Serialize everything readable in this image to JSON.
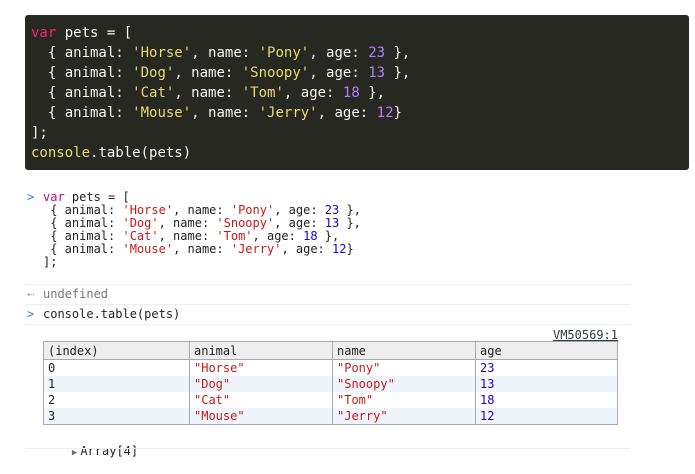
{
  "code_block": {
    "lines": [
      [
        {
          "t": "var",
          "c": "kw"
        },
        {
          "t": " pets = [",
          "c": ""
        }
      ],
      [
        {
          "t": "  { animal: ",
          "c": ""
        },
        {
          "t": "'Horse'",
          "c": "str"
        },
        {
          "t": ", name: ",
          "c": ""
        },
        {
          "t": "'Pony'",
          "c": "str"
        },
        {
          "t": ", age: ",
          "c": ""
        },
        {
          "t": "23",
          "c": "num"
        },
        {
          "t": " },",
          "c": ""
        }
      ],
      [
        {
          "t": "  { animal: ",
          "c": ""
        },
        {
          "t": "'Dog'",
          "c": "str"
        },
        {
          "t": ", name: ",
          "c": ""
        },
        {
          "t": "'Snoopy'",
          "c": "str"
        },
        {
          "t": ", age: ",
          "c": ""
        },
        {
          "t": "13",
          "c": "num"
        },
        {
          "t": " },",
          "c": ""
        }
      ],
      [
        {
          "t": "  { animal: ",
          "c": ""
        },
        {
          "t": "'Cat'",
          "c": "str"
        },
        {
          "t": ", name: ",
          "c": ""
        },
        {
          "t": "'Tom'",
          "c": "str"
        },
        {
          "t": ", age: ",
          "c": ""
        },
        {
          "t": "18",
          "c": "num"
        },
        {
          "t": " },",
          "c": ""
        }
      ],
      [
        {
          "t": "  { animal: ",
          "c": ""
        },
        {
          "t": "'Mouse'",
          "c": "str"
        },
        {
          "t": ", name: ",
          "c": ""
        },
        {
          "t": "'Jerry'",
          "c": "str"
        },
        {
          "t": ", age: ",
          "c": ""
        },
        {
          "t": "12",
          "c": "num"
        },
        {
          "t": "}",
          "c": ""
        }
      ],
      [
        {
          "t": "];",
          "c": ""
        }
      ],
      [
        {
          "t": "console",
          "c": "str"
        },
        {
          "t": ".table(pets)",
          "c": ""
        }
      ]
    ]
  },
  "console": {
    "input_lines": [
      [
        {
          "t": "var",
          "c": "c-kw"
        },
        {
          "t": " pets = [",
          "c": ""
        }
      ],
      [
        {
          "t": " { animal: ",
          "c": ""
        },
        {
          "t": "'Horse'",
          "c": "c-str"
        },
        {
          "t": ", name: ",
          "c": ""
        },
        {
          "t": "'Pony'",
          "c": "c-str"
        },
        {
          "t": ", age: ",
          "c": ""
        },
        {
          "t": "23",
          "c": "c-num"
        },
        {
          "t": " },",
          "c": ""
        }
      ],
      [
        {
          "t": " { animal: ",
          "c": ""
        },
        {
          "t": "'Dog'",
          "c": "c-str"
        },
        {
          "t": ", name: ",
          "c": ""
        },
        {
          "t": "'Snoopy'",
          "c": "c-str"
        },
        {
          "t": ", age: ",
          "c": ""
        },
        {
          "t": "13",
          "c": "c-num"
        },
        {
          "t": " },",
          "c": ""
        }
      ],
      [
        {
          "t": " { animal: ",
          "c": ""
        },
        {
          "t": "'Cat'",
          "c": "c-str"
        },
        {
          "t": ", name: ",
          "c": ""
        },
        {
          "t": "'Tom'",
          "c": "c-str"
        },
        {
          "t": ", age: ",
          "c": ""
        },
        {
          "t": "18",
          "c": "c-num"
        },
        {
          "t": " },",
          "c": ""
        }
      ],
      [
        {
          "t": " { animal: ",
          "c": ""
        },
        {
          "t": "'Mouse'",
          "c": "c-str"
        },
        {
          "t": ", name: ",
          "c": ""
        },
        {
          "t": "'Jerry'",
          "c": "c-str"
        },
        {
          "t": ", age: ",
          "c": ""
        },
        {
          "t": "12",
          "c": "c-num"
        },
        {
          "t": "}",
          "c": ""
        }
      ],
      [
        {
          "t": "];",
          "c": ""
        }
      ]
    ],
    "input_prompt": ">",
    "result_prompt": "⇠",
    "result_text": "undefined",
    "second_prompt": ">",
    "second_command": "console.table(pets)",
    "source_link": "VM50569:1",
    "table": {
      "headers": [
        "(index)",
        "animal",
        "name",
        "age"
      ],
      "rows": [
        {
          "index": "0",
          "animal": "\"Horse\"",
          "name": "\"Pony\"",
          "age": "23"
        },
        {
          "index": "1",
          "animal": "\"Dog\"",
          "name": "\"Snoopy\"",
          "age": "13"
        },
        {
          "index": "2",
          "animal": "\"Cat\"",
          "name": "\"Tom\"",
          "age": "18"
        },
        {
          "index": "3",
          "animal": "\"Mouse\"",
          "name": "\"Jerry\"",
          "age": "12"
        }
      ]
    },
    "array_toggle_icon": "triangle-right-icon",
    "array_label": "Array[4]"
  },
  "colors": {
    "code_bg": "#272822",
    "code_keyword": "#f92672",
    "code_string": "#e6db74",
    "code_number": "#ae81ff",
    "console_string": "#c41a16",
    "console_number": "#1c00cf",
    "console_prompt": "#367cf1",
    "table_stripe": "#f0f5fd"
  }
}
